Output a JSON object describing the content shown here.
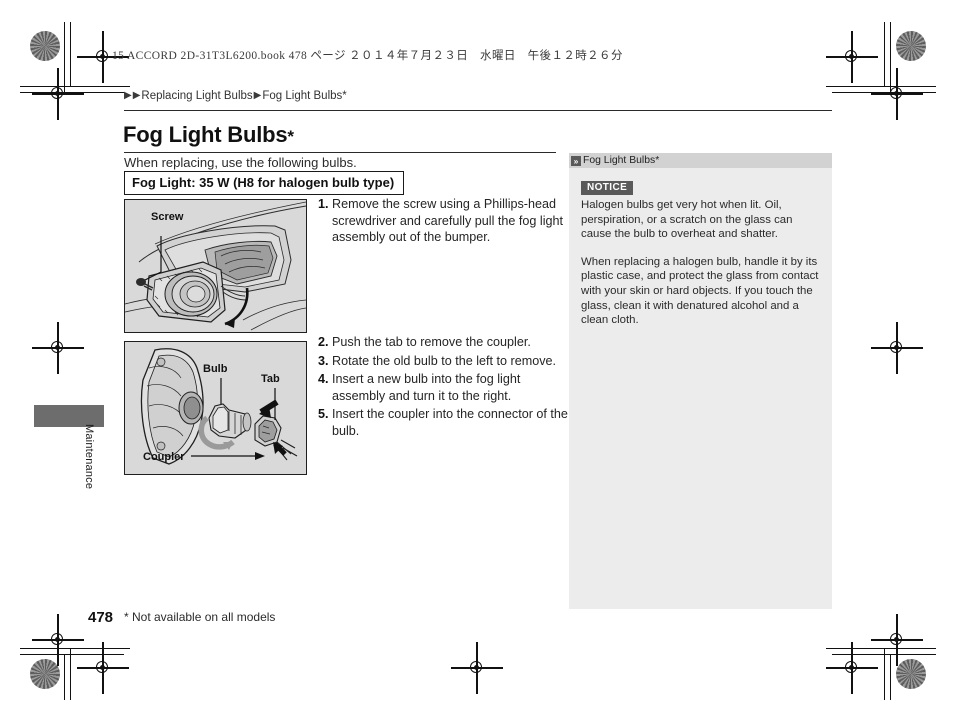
{
  "document": {
    "book_header": "15 ACCORD 2D-31T3L6200.book  478 ページ  ２０１４年７月２３日　水曜日　午後１２時２６分",
    "page_number": "478",
    "footnote": "* Not available on all models",
    "section_tab_label": "Maintenance"
  },
  "breadcrumb": {
    "marker_1": "▶",
    "marker_2": "▶",
    "crumb_1": "Replacing Light Bulbs",
    "marker_3": "▶",
    "crumb_2": "Fog Light Bulbs*"
  },
  "main": {
    "title": "Fog Light Bulbs",
    "title_star": "*",
    "intro": "When replacing, use the following bulbs.",
    "spec_box": "Fog Light: 35 W (H8 for halogen bulb type)",
    "steps_group_1": [
      {
        "number": "1.",
        "text": "Remove the screw using a Phillips-head screwdriver and carefully pull the fog light assembly out of the bumper."
      }
    ],
    "steps_group_2": [
      {
        "number": "2.",
        "text": "Push the tab to remove the coupler."
      },
      {
        "number": "3.",
        "text": "Rotate the old bulb to the left to remove."
      },
      {
        "number": "4.",
        "text": "Insert a new bulb into the fog light assembly and turn it to the right."
      },
      {
        "number": "5.",
        "text": "Insert the coupler into the connector of the bulb."
      }
    ]
  },
  "figures": {
    "fog_assembly": {
      "labels": {
        "screw": "Screw"
      }
    },
    "bulb_coupler": {
      "labels": {
        "bulb": "Bulb",
        "tab": "Tab",
        "coupler": "Coupler"
      }
    }
  },
  "side_panel": {
    "header_icon": "»",
    "header_title": "Fog Light Bulbs*",
    "notice_badge": "NOTICE",
    "paragraph_1": "Halogen bulbs get very hot when lit. Oil, perspiration, or a scratch on the glass can cause the bulb to overheat and shatter.",
    "paragraph_2": "When replacing a halogen bulb, handle it by its plastic case, and protect the glass from contact with your skin or hard objects. If you touch the glass, clean it with denatured alcohol and a clean cloth."
  },
  "colors": {
    "figure_background": "#d9d9d9",
    "panel_background": "#ececec",
    "panel_header": "#d2d2d2",
    "badge": "#5a5a5a",
    "tab": "#6d6d6d",
    "text": "#231f20"
  }
}
